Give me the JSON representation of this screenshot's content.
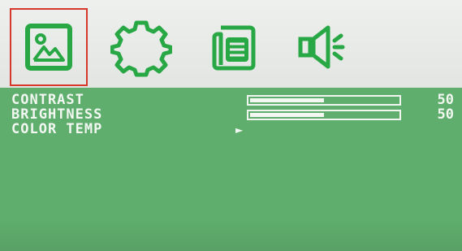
{
  "tabs": [
    {
      "icon": "picture-icon",
      "active": true
    },
    {
      "icon": "gear-icon",
      "active": false
    },
    {
      "icon": "document-icon",
      "active": false
    },
    {
      "icon": "speaker-icon",
      "active": false
    }
  ],
  "menu": {
    "items": [
      {
        "label": "CONTRAST",
        "level": 0.5,
        "value": "50"
      },
      {
        "label": "BRIGHTNESS",
        "level": 0.5,
        "value": "50"
      },
      {
        "label": "COLOR TEMP",
        "pointer": "►"
      }
    ]
  },
  "colors": {
    "icon_green": "#28a745",
    "active_border": "#d6392c",
    "menu_background": "#5fae6d",
    "menu_text": "#f3f7f2"
  }
}
